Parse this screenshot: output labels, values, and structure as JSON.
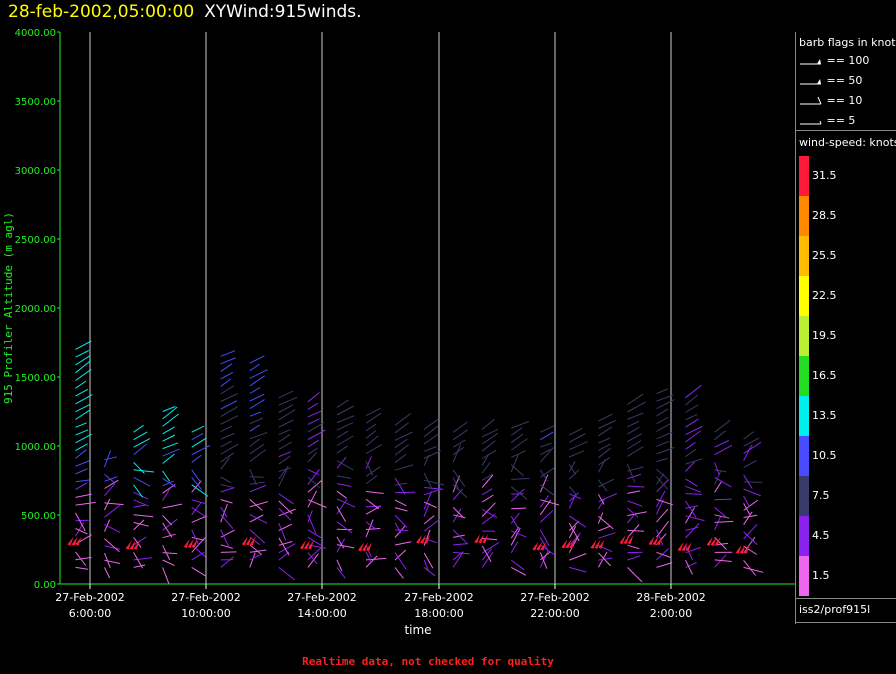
{
  "header": {
    "datetime": "28-feb-2002,05:00:00",
    "product": "XYWind:915winds."
  },
  "footer": {
    "note": "Realtime data, not checked for quality"
  },
  "legend": {
    "barb_title": "barb flags in knots",
    "barb_flags": [
      "== 100",
      "== 50",
      "== 10",
      "== 5"
    ],
    "speed_title": "wind-speed: knots",
    "speed_scale": [
      {
        "label": "31.5",
        "color": "#ff1a3a"
      },
      {
        "label": "28.5",
        "color": "#ff8800"
      },
      {
        "label": "25.5",
        "color": "#ffbb00"
      },
      {
        "label": "22.5",
        "color": "#ffff00"
      },
      {
        "label": "19.5",
        "color": "#bbee33"
      },
      {
        "label": "16.5",
        "color": "#22dd22"
      },
      {
        "label": "13.5",
        "color": "#00eeee"
      },
      {
        "label": "10.5",
        "color": "#4a4aff"
      },
      {
        "label": "7.5",
        "color": "#3a3a6a"
      },
      {
        "label": "4.5",
        "color": "#8a22ee"
      },
      {
        "label": "1.5",
        "color": "#ee66ee"
      }
    ],
    "source": "iss2/prof915l"
  },
  "chart_data": {
    "type": "scatter",
    "title": "28-feb-2002,05:00:00  XYWind:915winds.",
    "xlabel": "time",
    "ylabel": "915 Profiler Altitude (m agl)",
    "ylim": [
      0,
      4000
    ],
    "y_ticks": [
      "4000.00",
      "3500.00",
      "3000.00",
      "2500.00",
      "2000.00",
      "1500.00",
      "1000.00",
      "500.00",
      "0.00"
    ],
    "x_ticks": [
      {
        "date": "27-Feb-2002",
        "time": "6:00:00"
      },
      {
        "date": "27-Feb-2002",
        "time": "10:00:00"
      },
      {
        "date": "27-Feb-2002",
        "time": "14:00:00"
      },
      {
        "date": "27-Feb-2002",
        "time": "18:00:00"
      },
      {
        "date": "27-Feb-2002",
        "time": "22:00:00"
      },
      {
        "date": "28-Feb-2002",
        "time": "2:00:00"
      }
    ],
    "xlim": [
      "2002-02-27T05:00:00",
      "2002-02-28T05:00:00"
    ],
    "grid": "vertical lines at labeled times",
    "series": [
      {
        "time": "2002-02-27T05:30",
        "top": 1700,
        "speed": 12
      },
      {
        "time": "2002-02-27T06:30",
        "top": 900,
        "speed": 9
      },
      {
        "time": "2002-02-27T07:30",
        "top": 1100,
        "speed": 11
      },
      {
        "time": "2002-02-27T08:30",
        "top": 1250,
        "speed": 12
      },
      {
        "time": "2002-02-27T09:30",
        "top": 1100,
        "speed": 11
      },
      {
        "time": "2002-02-27T10:30",
        "top": 1650,
        "speed": 8
      },
      {
        "time": "2002-02-27T11:30",
        "top": 1600,
        "speed": 9
      },
      {
        "time": "2002-02-27T12:30",
        "top": 1350,
        "speed": 6
      },
      {
        "time": "2002-02-27T13:30",
        "top": 1320,
        "speed": 5
      },
      {
        "time": "2002-02-27T14:30",
        "top": 1280,
        "speed": 6
      },
      {
        "time": "2002-02-27T15:30",
        "top": 1220,
        "speed": 6
      },
      {
        "time": "2002-02-27T16:30",
        "top": 1150,
        "speed": 6
      },
      {
        "time": "2002-02-27T17:30",
        "top": 1120,
        "speed": 6
      },
      {
        "time": "2002-02-27T18:30",
        "top": 1100,
        "speed": 6
      },
      {
        "time": "2002-02-27T19:30",
        "top": 1120,
        "speed": 6
      },
      {
        "time": "2002-02-27T20:30",
        "top": 1130,
        "speed": 6
      },
      {
        "time": "2002-02-27T21:30",
        "top": 1100,
        "speed": 7
      },
      {
        "time": "2002-02-27T22:30",
        "top": 1080,
        "speed": 7
      },
      {
        "time": "2002-02-27T23:30",
        "top": 1180,
        "speed": 7
      },
      {
        "time": "2002-02-28T00:30",
        "top": 1300,
        "speed": 6
      },
      {
        "time": "2002-02-28T01:30",
        "top": 1380,
        "speed": 6
      },
      {
        "time": "2002-02-28T02:30",
        "top": 1350,
        "speed": 5
      },
      {
        "time": "2002-02-28T03:30",
        "top": 1100,
        "speed": 5
      },
      {
        "time": "2002-02-28T04:30",
        "top": 1050,
        "speed": 5
      }
    ]
  }
}
